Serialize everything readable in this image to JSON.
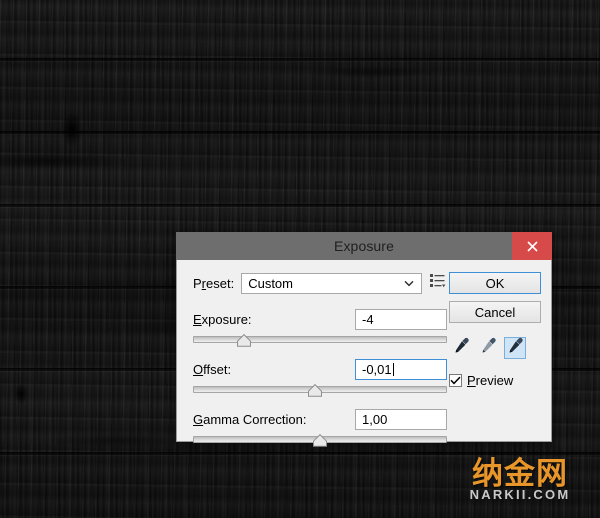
{
  "dialog": {
    "title": "Exposure",
    "close_icon": "close-x-icon",
    "preset": {
      "label": "Preset:",
      "label_mnemonic": "r",
      "value": "Custom",
      "options": [
        "Custom"
      ],
      "arrow_icon": "chevron-down-icon",
      "options_button_icon": "preset-options-list-icon"
    },
    "sliders": [
      {
        "key": "exposure",
        "label": "Exposure:",
        "label_mnemonic": "E",
        "value": "-4",
        "thumb_percent": 20,
        "focused": false
      },
      {
        "key": "offset",
        "label": "Offset:",
        "label_mnemonic": "O",
        "value": "-0,01",
        "thumb_percent": 48,
        "focused": true
      },
      {
        "key": "gamma_correction",
        "label": "Gamma Correction:",
        "label_mnemonic": "G",
        "value": "1,00",
        "thumb_percent": 50,
        "focused": false
      }
    ],
    "buttons": {
      "ok": "OK",
      "cancel": "Cancel"
    },
    "eyedroppers": [
      {
        "name": "set-black-point-eyedropper-icon",
        "selected": false
      },
      {
        "name": "set-gray-point-eyedropper-icon",
        "selected": false
      },
      {
        "name": "set-white-point-eyedropper-icon",
        "selected": true
      }
    ],
    "preview": {
      "label": "Preview",
      "label_mnemonic": "P",
      "checked": true,
      "check_icon": "checkmark-icon"
    }
  },
  "watermark": {
    "chinese": "纳金网",
    "latin": "NARKII.COM",
    "color": "#e8962a"
  },
  "colors": {
    "titlebar": "#6e6e6e",
    "dialog_body": "#f0f0f0",
    "close_button": "#d64a4a",
    "focus_blue": "#3f8fd6",
    "selected_tool": "#cfe4f7",
    "background": "#161616"
  }
}
